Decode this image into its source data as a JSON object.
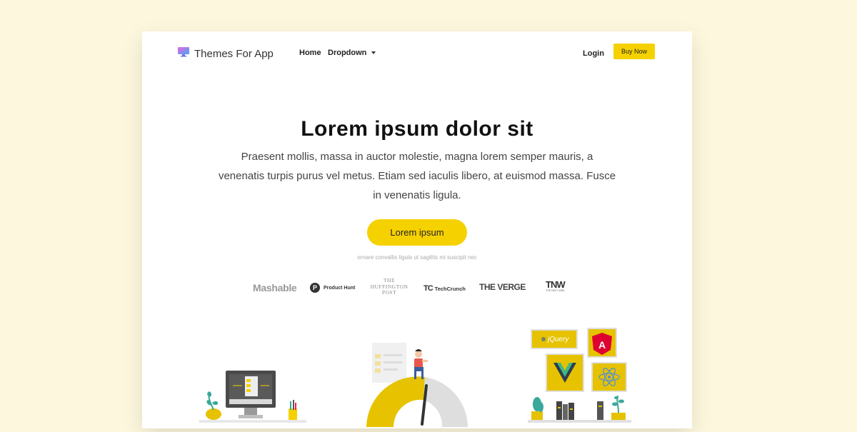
{
  "brand": {
    "name": "Themes For App",
    "icon": "monitor-icon"
  },
  "nav": {
    "home": "Home",
    "dropdown": "Dropdown",
    "login": "Login",
    "buy_now": "Buy Now"
  },
  "hero": {
    "title": "Lorem ipsum dolor sit",
    "subtitle": "Praesent mollis, massa in auctor molestie, magna lorem semper mauris, a venenatis turpis purus vel metus. Etiam sed iaculis libero, at euismod massa. Fusce in venenatis ligula.",
    "cta": "Lorem ipsum",
    "note": "ornare convallis ligula ut sagittis mi suscipit nec"
  },
  "press_logos": {
    "mashable": "Mashable",
    "producthunt_mark": "P",
    "producthunt": "Product Hunt",
    "huffington": [
      "THE",
      "HUFFINGTON",
      "POST"
    ],
    "techcrunch_mark": "TC",
    "techcrunch": "TechCrunch",
    "verge": "THE VERGE",
    "tnw": "TNW",
    "tnw_sub": "THE NEXT WEB"
  },
  "illustrations": {
    "jquery": "jQuery",
    "angular": "A"
  },
  "colors": {
    "accent": "#f6d100",
    "background": "#fdf8dd",
    "page": "#ffffff",
    "text_dark": "#111111",
    "text_body": "#444444"
  }
}
